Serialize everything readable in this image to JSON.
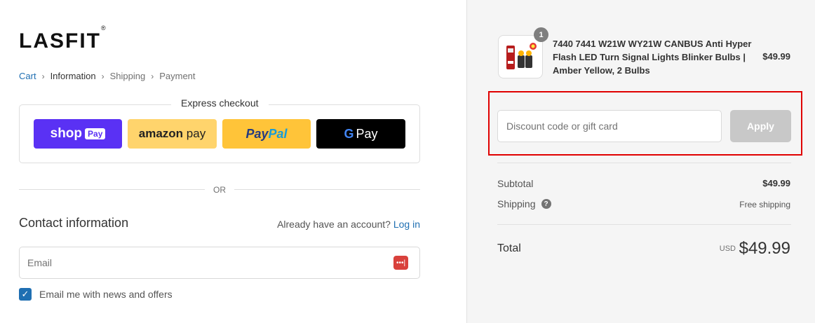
{
  "brand": {
    "logo_text": "LASFIT",
    "trademark": "®"
  },
  "breadcrumb": {
    "items": [
      "Cart",
      "Information",
      "Shipping",
      "Payment"
    ],
    "separator": "›"
  },
  "express_checkout": {
    "title": "Express checkout",
    "shop_pay": {
      "shop": "shop",
      "pay": "Pay"
    },
    "amazon_pay": {
      "amazon": "amazon",
      "pay": "pay"
    },
    "paypal": {
      "pay": "Pay",
      "pal": "Pal"
    },
    "google_pay": {
      "g": "G",
      "pay": "Pay"
    }
  },
  "or_divider": "OR",
  "contact": {
    "heading": "Contact information",
    "account_prompt": "Already have an account?",
    "login_label": "Log in",
    "email_placeholder": "Email",
    "newsletter_label": "Email me with news and offers",
    "newsletter_checked": true
  },
  "order_summary": {
    "product": {
      "name": "7440 7441 W21W WY21W CANBUS Anti Hyper Flash LED Turn Signal Lights Blinker Bulbs | Amber Yellow, 2 Bulbs",
      "price": "$49.99",
      "quantity": "1"
    },
    "discount": {
      "placeholder": "Discount code or gift card",
      "apply_label": "Apply"
    },
    "subtotal_label": "Subtotal",
    "subtotal_value": "$49.99",
    "shipping_label": "Shipping",
    "shipping_value": "Free shipping",
    "total_label": "Total",
    "currency": "USD",
    "total_value": "$49.99"
  },
  "colors": {
    "link": "#1f6fb2",
    "shop_pay": "#5a31f4",
    "amazon_pay": "#ffd46c",
    "paypal": "#ffc439",
    "highlight_box": "#e00000",
    "apply_disabled": "#c8c8c8"
  }
}
